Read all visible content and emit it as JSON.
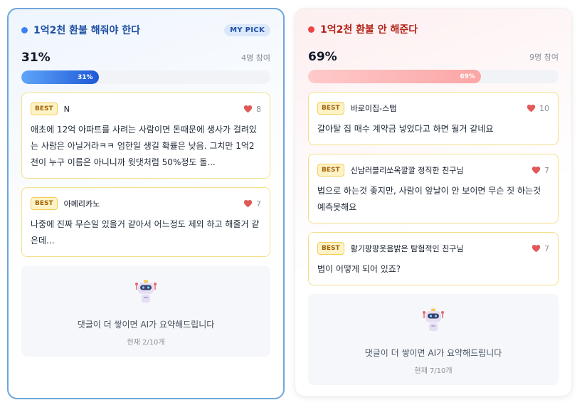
{
  "left": {
    "title": "1억2천 환불 해줘야 한다",
    "pick_badge": "MY PICK",
    "percent": "31%",
    "participants": "4명 참여",
    "bar_label": "31%",
    "bar_fraction": 0.31,
    "comments": [
      {
        "badge": "BEST",
        "author": "N",
        "likes": "8",
        "text": "애초에 12억 아파트를 사려는 사람이면 돈때문에 생사가 걸려있는 사람은 아닐거라ㅋㅋ 엄한일 생길 확률은 낮음. 그치만 1억2천이 누구 이름은 아니니까 윗댓처럼 50%정도 돌..."
      },
      {
        "badge": "BEST",
        "author": "아메리카노",
        "likes": "7",
        "text": "나중에 진짜 무슨일 있을거 같아서 어느정도 제외 하고 해줄거 같은데..."
      }
    ],
    "ai": {
      "message": "댓글이 더 쌓이면 AI가 요약해드립니다",
      "count": "현재 2/10개"
    }
  },
  "right": {
    "title": "1억2천 환불 안 해준다",
    "percent": "69%",
    "participants": "9명 참여",
    "bar_label": "69%",
    "bar_fraction": 0.69,
    "comments": [
      {
        "badge": "BEST",
        "author": "바로이집-스탭",
        "likes": "10",
        "text": "갈아탈 집 매수 계약금 넣었다고 하면 될거 같네요"
      },
      {
        "badge": "BEST",
        "author": "신남러블리쏘옥깔깔 정직한 친구님",
        "likes": "7",
        "text": "법으로 하는것 좋지만, 사람이 앞날이 안 보이면 무슨 짓 하는것 예측못해요"
      },
      {
        "badge": "BEST",
        "author": "활기팡팡웃음밝은 탐험적인 친구님",
        "likes": "7",
        "text": "법이 어떻게 되어 있죠?"
      }
    ],
    "ai": {
      "message": "댓글이 더 쌓이면 AI가 요약해드립니다",
      "count": "현재 7/10개"
    }
  },
  "colors": {
    "left_accent": "#3b82f6",
    "right_accent": "#ef4444",
    "best_badge": "#fef3c7",
    "heart": "#e05a5a"
  },
  "icons": {
    "heart": "heart-icon",
    "robot": "robot-icon"
  }
}
